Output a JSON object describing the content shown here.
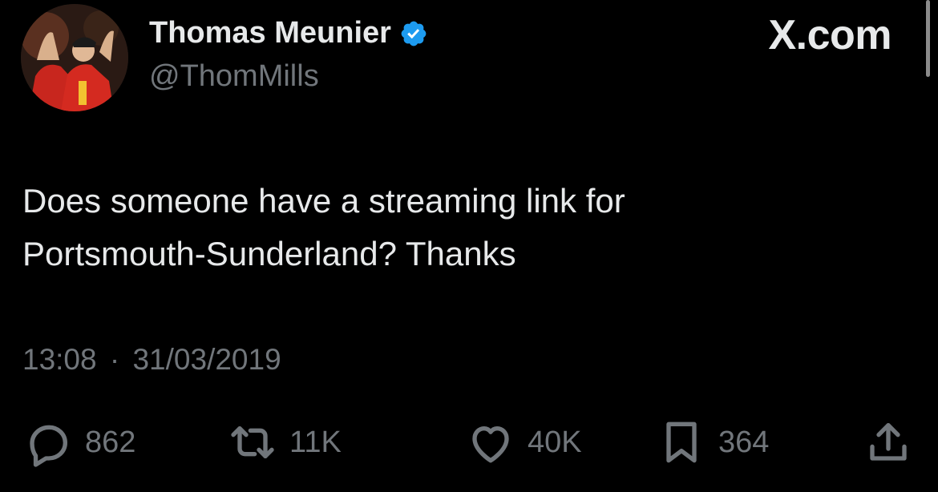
{
  "author": {
    "display_name": "Thomas Meunier",
    "handle": "@ThomMills",
    "verified": true
  },
  "brand": "X.com",
  "tweet": {
    "text_lines": [
      "Does someone have a streaming link for",
      "Portsmouth-Sunderland? Thanks"
    ],
    "time": "13:08",
    "separator": "·",
    "date": "31/03/2019"
  },
  "actions": {
    "replies": {
      "icon": "reply-icon",
      "count": "862"
    },
    "reposts": {
      "icon": "repost-icon",
      "count": "11K"
    },
    "likes": {
      "icon": "heart-icon",
      "count": "40K"
    },
    "bookmarks": {
      "icon": "bookmark-icon",
      "count": "364"
    },
    "share": {
      "icon": "share-icon"
    }
  },
  "colors": {
    "background": "#000000",
    "primary_text": "#e7e9ea",
    "secondary_text": "#71767b",
    "verified_badge": "#1d9bf0"
  }
}
